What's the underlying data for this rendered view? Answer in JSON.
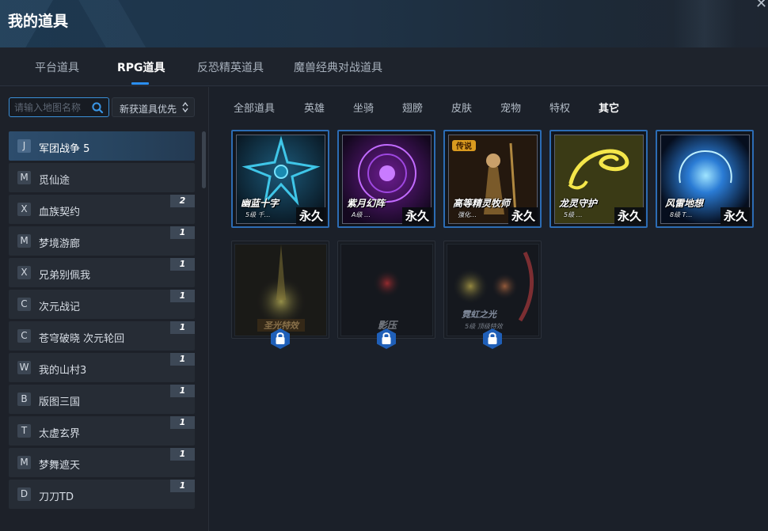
{
  "window": {
    "title": "我的道具"
  },
  "tabs": [
    {
      "label": "平台道具"
    },
    {
      "label": "RPG道具"
    },
    {
      "label": "反恐精英道具"
    },
    {
      "label": "魔兽经典对战道具"
    }
  ],
  "search": {
    "placeholder": "请输入地图名称"
  },
  "sort": {
    "label": "新获道具优先"
  },
  "games": [
    {
      "letter": "J",
      "name": "军团战争 5",
      "count": ""
    },
    {
      "letter": "M",
      "name": "觅仙途",
      "count": ""
    },
    {
      "letter": "X",
      "name": "血族契约",
      "count": "2"
    },
    {
      "letter": "M",
      "name": "梦境游廊",
      "count": "1"
    },
    {
      "letter": "X",
      "name": "兄弟别佩我",
      "count": "1"
    },
    {
      "letter": "C",
      "name": "次元战记",
      "count": "1"
    },
    {
      "letter": "C",
      "name": "苍穹破晓 次元轮回",
      "count": "1"
    },
    {
      "letter": "W",
      "name": "我的山村3",
      "count": "1"
    },
    {
      "letter": "B",
      "name": "版图三国",
      "count": "1"
    },
    {
      "letter": "T",
      "name": "太虚玄界",
      "count": "1"
    },
    {
      "letter": "M",
      "name": "梦舞遮天",
      "count": "1"
    },
    {
      "letter": "D",
      "name": "刀刀TD",
      "count": "1"
    }
  ],
  "filters": [
    "全部道具",
    "英雄",
    "坐骑",
    "翅膀",
    "皮肤",
    "宠物",
    "特权",
    "其它"
  ],
  "active_filter": "其它",
  "items": [
    {
      "name": "幽蓝十字",
      "sub": "5级 千…",
      "badge": "永久",
      "locked": false,
      "icon": "blue-cross-art"
    },
    {
      "name": "紫月幻阵",
      "sub": "A级 …",
      "badge": "永久",
      "locked": false,
      "icon": "purple-circle-art"
    },
    {
      "name": "高等精灵牧师",
      "sub": "强化…",
      "badge": "永久",
      "tag": "传说",
      "locked": false,
      "icon": "elf-priest-art"
    },
    {
      "name": "龙灵守护",
      "sub": "5级 …",
      "badge": "永久",
      "locked": false,
      "icon": "golden-dragon-art"
    },
    {
      "name": "风雷地想",
      "sub": "8级 T…",
      "badge": "永久",
      "locked": false,
      "icon": "blue-lightning-art"
    },
    {
      "name": "圣光特效",
      "locked": true,
      "icon": "holy-light-art"
    },
    {
      "name": "影压",
      "locked": true,
      "icon": "shadow-art"
    },
    {
      "name": "霓虹之光",
      "sub": "5级 顶级特效",
      "locked": true,
      "icon": "neon-light-art"
    }
  ],
  "colors": {
    "accent": "#2b8ef0",
    "item_border": "#2c6cb4"
  }
}
